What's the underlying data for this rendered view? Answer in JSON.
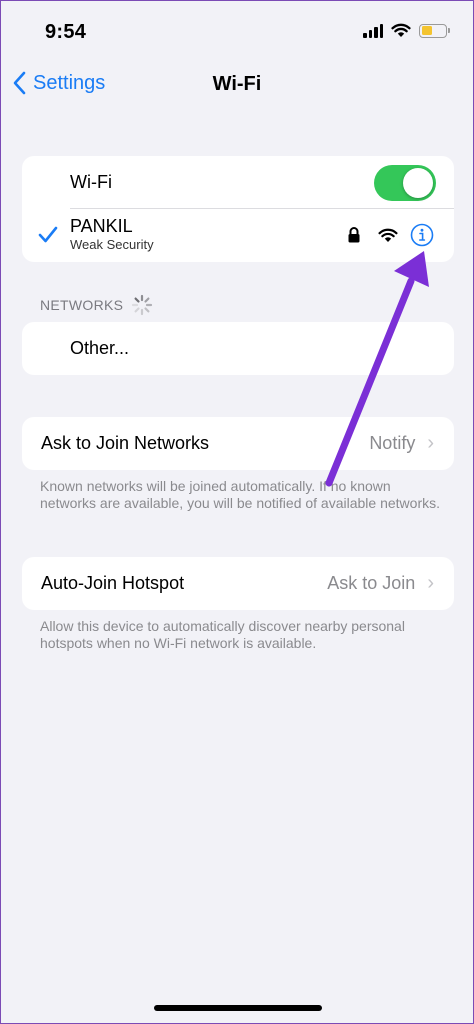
{
  "status_bar": {
    "time": "9:54"
  },
  "nav": {
    "back_label": "Settings",
    "title": "Wi-Fi"
  },
  "wifi_group": {
    "toggle_label": "Wi-Fi",
    "toggle_on": true,
    "connected_network": {
      "name": "PANKIL",
      "subtitle": "Weak Security",
      "checked": true
    }
  },
  "networks_section": {
    "header": "NETWORKS",
    "other_label": "Other..."
  },
  "ask_to_join": {
    "label": "Ask to Join Networks",
    "value": "Notify",
    "note": "Known networks will be joined automatically. If no known networks are available, you will be notified of available networks."
  },
  "auto_join": {
    "label": "Auto-Join Hotspot",
    "value": "Ask to Join",
    "note": "Allow this device to automatically discover nearby personal hotspots when no Wi-Fi network is available."
  },
  "colors": {
    "accent": "#1a7cf5",
    "toggle_on": "#34c759",
    "annotation_arrow": "#7b2fd6",
    "background": "#f2f2f7"
  },
  "icons": [
    "signal-icon",
    "wifi-icon",
    "battery-icon",
    "chevron-left-icon",
    "checkmark-icon",
    "lock-icon",
    "wifi-strength-icon",
    "info-icon",
    "loading-spinner-icon",
    "chevron-right-icon"
  ]
}
